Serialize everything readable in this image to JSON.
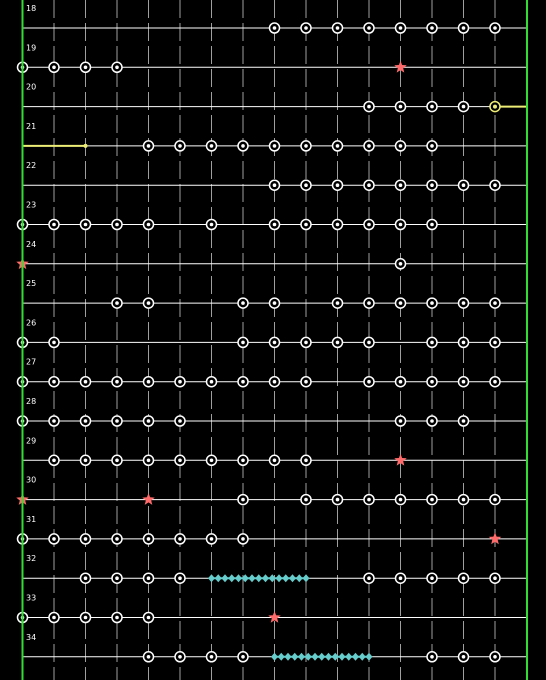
{
  "colors": {
    "background": "#000000",
    "lane_line": "#ffffff",
    "border": "#33dd33",
    "hold": "#eeee77",
    "mine": "#ff6b6b",
    "drag": "#66cccc",
    "note_ring": "#ffffff"
  },
  "lanes": 16,
  "measures": [
    {
      "label": "18",
      "notes": [
        8,
        9,
        10,
        11,
        12,
        13,
        14,
        15
      ],
      "mines": [],
      "hold": null,
      "drag": null
    },
    {
      "label": "19",
      "notes": [
        0,
        1,
        2,
        3
      ],
      "mines": [
        12
      ],
      "hold": null,
      "drag": null
    },
    {
      "label": "20",
      "notes": [
        11,
        12,
        13,
        14
      ],
      "mines": [],
      "hold": {
        "from": 15,
        "to": 16,
        "head": 15
      },
      "drag": null
    },
    {
      "label": "21",
      "notes": [
        4,
        5,
        6,
        7,
        8,
        9,
        10,
        11,
        12,
        13
      ],
      "mines": [],
      "hold": {
        "from": 0,
        "to": 2,
        "head": 2
      },
      "drag": null
    },
    {
      "label": "22",
      "notes": [
        8,
        9,
        10,
        11,
        12,
        13,
        14,
        15
      ],
      "mines": [],
      "hold": null,
      "drag": null
    },
    {
      "label": "23",
      "notes": [
        0,
        1,
        2,
        3,
        4,
        6,
        8,
        9,
        10,
        11,
        12,
        13
      ],
      "mines": [],
      "hold": null,
      "drag": null
    },
    {
      "label": "24",
      "notes": [
        12
      ],
      "mines": [
        0
      ],
      "hold": null,
      "drag": null
    },
    {
      "label": "25",
      "notes": [
        3,
        4,
        7,
        8,
        10,
        11,
        12,
        13,
        14,
        15
      ],
      "mines": [],
      "hold": null,
      "drag": null
    },
    {
      "label": "26",
      "notes": [
        0,
        1,
        7,
        8,
        9,
        10,
        11,
        13,
        14,
        15
      ],
      "mines": [],
      "hold": null,
      "drag": null
    },
    {
      "label": "27",
      "notes": [
        0,
        1,
        2,
        3,
        4,
        5,
        6,
        7,
        8,
        9,
        11,
        12,
        13,
        14,
        15
      ],
      "mines": [],
      "hold": null,
      "drag": null
    },
    {
      "label": "28",
      "notes": [
        0,
        1,
        2,
        3,
        4,
        5,
        12,
        13,
        14
      ],
      "mines": [],
      "hold": null,
      "drag": null
    },
    {
      "label": "29",
      "notes": [
        1,
        2,
        3,
        4,
        5,
        6,
        7,
        8,
        9
      ],
      "mines": [
        12
      ],
      "hold": null,
      "drag": null
    },
    {
      "label": "30",
      "notes": [
        7,
        9,
        10,
        11,
        12,
        13,
        14,
        15
      ],
      "mines": [
        0,
        4
      ],
      "hold": null,
      "drag": null
    },
    {
      "label": "31",
      "notes": [
        0,
        1,
        2,
        3,
        4,
        5,
        6,
        7
      ],
      "mines": [
        15
      ],
      "hold": null,
      "drag": null
    },
    {
      "label": "32",
      "notes": [
        2,
        3,
        4,
        5,
        11,
        12,
        13,
        14,
        15
      ],
      "mines": [],
      "hold": null,
      "drag": {
        "from": 6,
        "to": 9
      }
    },
    {
      "label": "33",
      "notes": [
        0,
        1,
        2,
        3,
        4
      ],
      "mines": [
        8
      ],
      "hold": null,
      "drag": null
    },
    {
      "label": "34",
      "notes": [
        4,
        5,
        6,
        7,
        13,
        14,
        15
      ],
      "mines": [],
      "hold": null,
      "drag": {
        "from": 8,
        "to": 11
      }
    }
  ]
}
